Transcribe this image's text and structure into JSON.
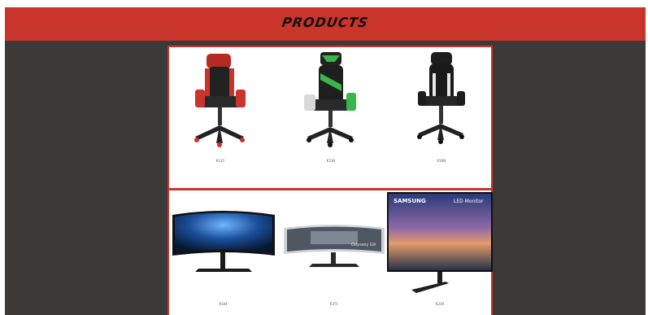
{
  "header": {
    "title": "PRODUCTS"
  },
  "chairs": [
    {
      "price": "€125",
      "color": "#c9342b",
      "icon": "gaming-chair-red"
    },
    {
      "price": "€230",
      "color": "#39b54a",
      "icon": "gaming-chair-green"
    },
    {
      "price": "€180",
      "color": "#ffffff",
      "icon": "gaming-chair-black"
    }
  ],
  "monitors": [
    {
      "price": "€181",
      "icon": "curved-monitor-blue"
    },
    {
      "price": "€371",
      "icon": "curved-monitor-odyssey",
      "screen_text": "Odyssey G9"
    },
    {
      "price": "€239",
      "icon": "samsung-monitor",
      "brand": "SAMSUNG",
      "screen_text": "LED Monitor"
    }
  ],
  "colors": {
    "accent": "#c9342b",
    "background": "#3b3a39",
    "panel": "#ffffff"
  }
}
